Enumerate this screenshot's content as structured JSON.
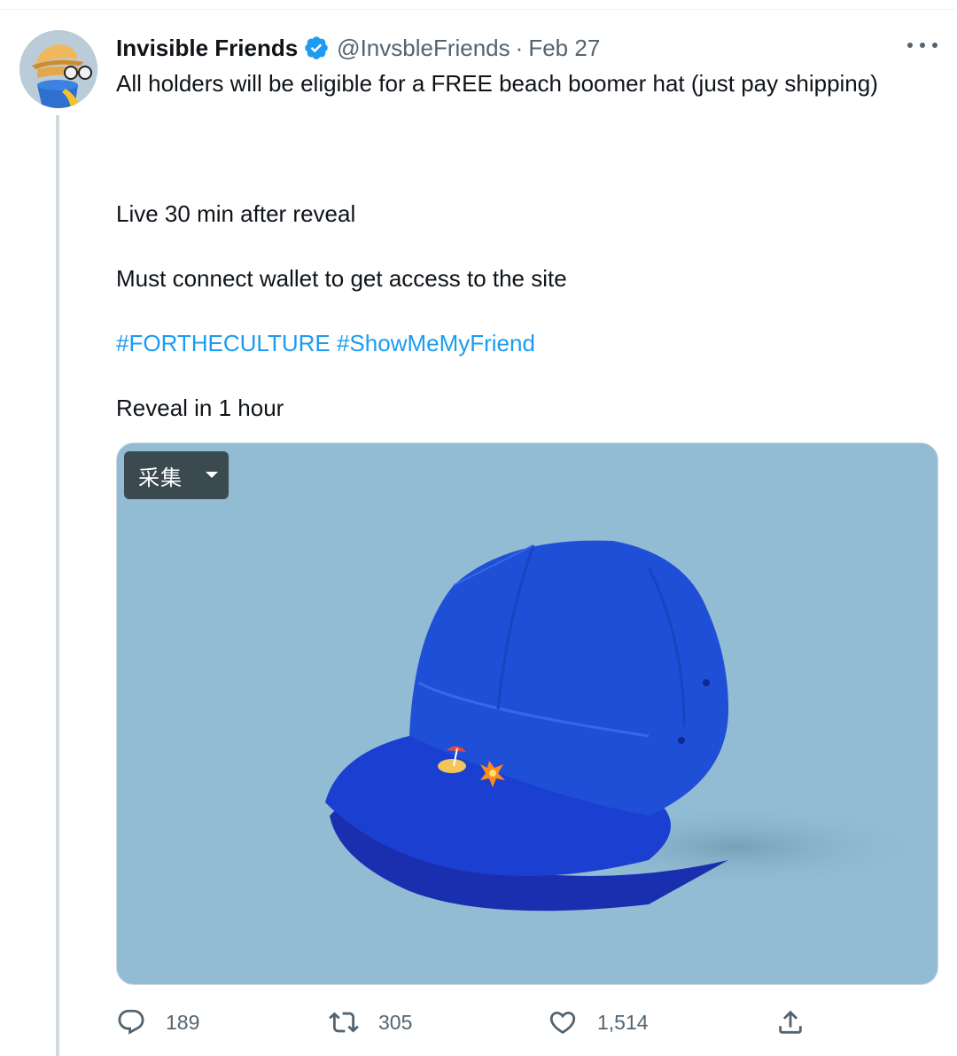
{
  "tweet": {
    "author": {
      "display_name": "Invisible Friends",
      "handle": "@InvsbleFriends",
      "verified": true,
      "avatar_icon": "avatar-cartoon-character"
    },
    "separator": "·",
    "date": "Feb 27",
    "more_icon": "more-horizontal-icon",
    "text_lines": [
      "All holders will be eligible for a FREE beach boomer hat (just pay shipping)",
      "Live 30 min after reveal",
      "Must connect wallet to get access to the site",
      "Reveal in 1 hour"
    ],
    "hashtags": [
      "#FORTHECULTURE",
      "#ShowMeMyFriend"
    ],
    "media": {
      "description_icon": "blue-cap-image",
      "overlay_button_label": "采集"
    },
    "actions": {
      "reply": {
        "icon": "reply-icon",
        "count": "189"
      },
      "retweet": {
        "icon": "retweet-icon",
        "count": "305"
      },
      "like": {
        "icon": "heart-icon",
        "count": "1,514"
      },
      "share": {
        "icon": "share-icon"
      }
    }
  },
  "colors": {
    "link": "#1d9bf0",
    "secondary_text": "#536471",
    "media_background": "#92bcd3",
    "cap_blue": "#1f4fd6"
  }
}
